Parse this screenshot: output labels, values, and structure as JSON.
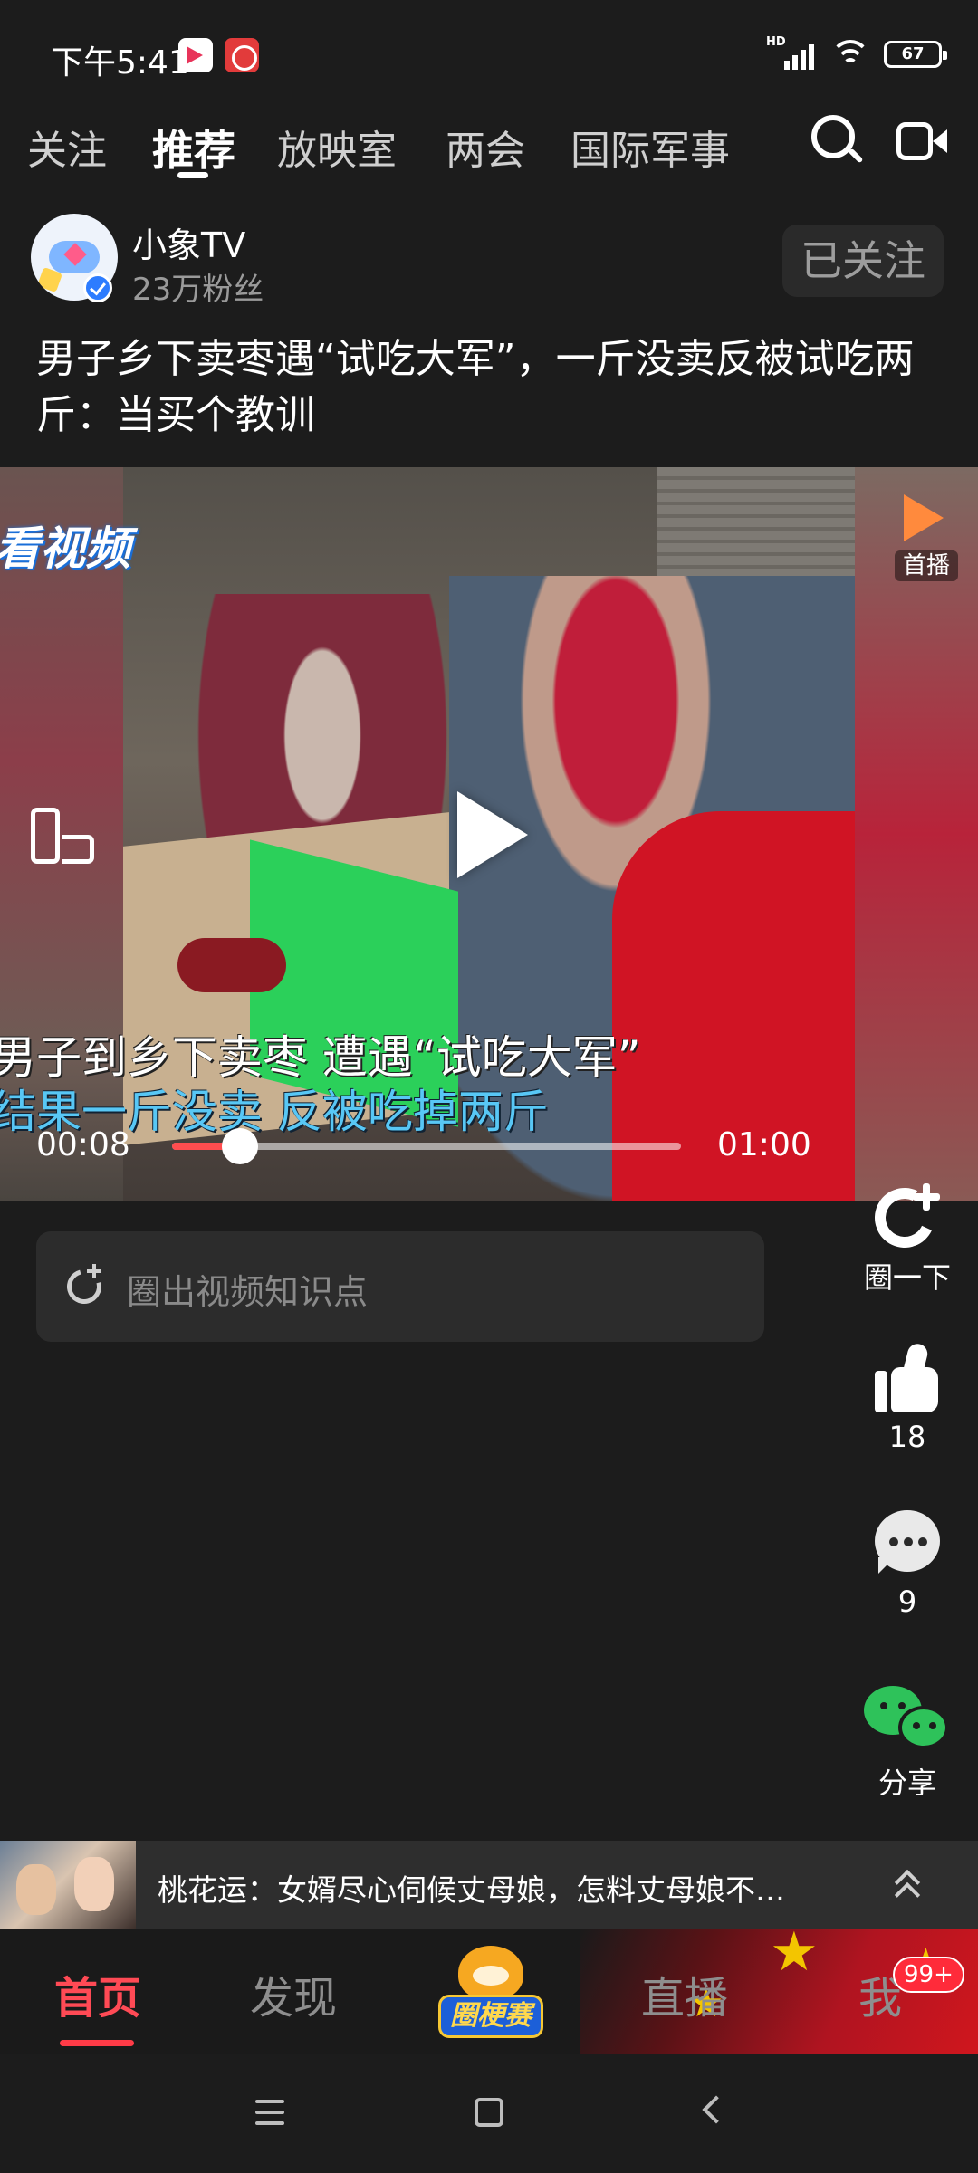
{
  "status_bar": {
    "time": "下午5:41",
    "network_label": "HD",
    "battery_level": "67"
  },
  "top_tabs": [
    {
      "label": "关注",
      "active": false
    },
    {
      "label": "推荐",
      "active": true
    },
    {
      "label": "放映室",
      "active": false
    },
    {
      "label": "两会",
      "active": false
    },
    {
      "label": "国际军事",
      "active": false
    }
  ],
  "icons": {
    "search": "search-icon",
    "camera": "video-camera-icon"
  },
  "author": {
    "name": "小象TV",
    "fans": "23万粉丝",
    "follow_label": "已关注"
  },
  "video": {
    "title": "男子乡下卖枣遇“试吃大军”，一斤没卖反被试吃两斤：当买个教训",
    "watermark": "看视频",
    "first_play_label": "首播",
    "subtitle_line1": "男子到乡下卖枣 遭遇“试吃大军”",
    "subtitle_line2": "结果一斤没卖 反被吃掉两斤",
    "current_time": "00:08",
    "total_time": "01:00",
    "progress_fraction": 0.133
  },
  "knowledge": {
    "placeholder": "圈出视频知识点"
  },
  "actions": {
    "circle_label": "圈一下",
    "like_count": "18",
    "comment_count": "9",
    "share_label": "分享"
  },
  "related": {
    "title": "桃花运：女婿尽心伺候丈母娘，怎料丈母娘不…"
  },
  "bottom_nav": {
    "home": "首页",
    "discover": "发现",
    "center_badge": "圈梗赛",
    "live": "直播",
    "me": "我",
    "notification_count": "99+"
  },
  "colors": {
    "accent": "#ff4a55",
    "background": "#1c1c1c",
    "progress": "#ff4d4f",
    "wechat_green": "#2ec25a"
  }
}
